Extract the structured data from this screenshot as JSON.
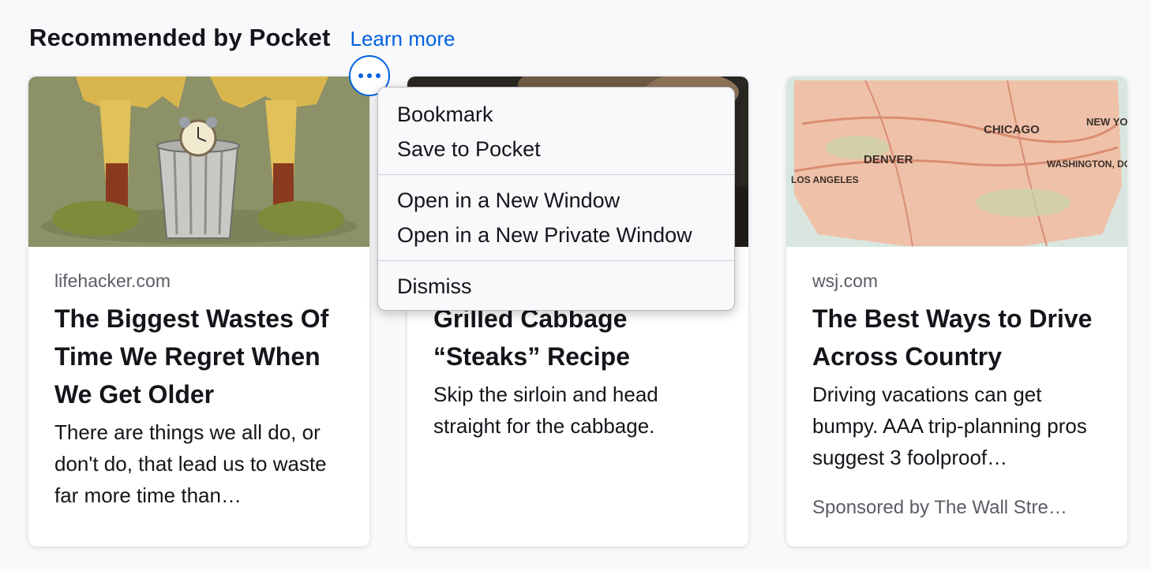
{
  "section": {
    "title": "Recommended by Pocket",
    "learn_more": "Learn more"
  },
  "cards": [
    {
      "source": "lifehacker.com",
      "headline": "The Biggest Wastes Of Time We Regret When We Get Older",
      "excerpt": "There are things we all do, or don't do, that lead us to waste far more time than…",
      "thumbnail": "legs-trash-can-clock-image"
    },
    {
      "source": "",
      "headline": "Grilled Cabbage “Steaks” Recipe",
      "excerpt": "Skip the sirloin and head straight for the cabbage.",
      "thumbnail": "grilled-cabbage-image"
    },
    {
      "source": "wsj.com",
      "headline": "The Best Ways to Drive Across Country",
      "excerpt": "Driving vacations can get bumpy. AAA trip-planning pros suggest 3 foolproof…",
      "sponsor": "Sponsored by The Wall Stre…",
      "thumbnail": "illustrated-usa-map-image",
      "map_labels": [
        "CHICAGO",
        "NEW YORK",
        "DENVER",
        "LOS ANGELES",
        "WASHINGTON, DC."
      ]
    }
  ],
  "context_menu": {
    "button_icon": "ellipsis-icon",
    "items": [
      "Bookmark",
      "Save to Pocket",
      "Open in a New Window",
      "Open in a New Private Window",
      "Dismiss"
    ]
  },
  "colors": {
    "accent": "#0061e0",
    "background": "#f9f9fb",
    "card": "#ffffff",
    "muted_text": "#5b5b66"
  }
}
